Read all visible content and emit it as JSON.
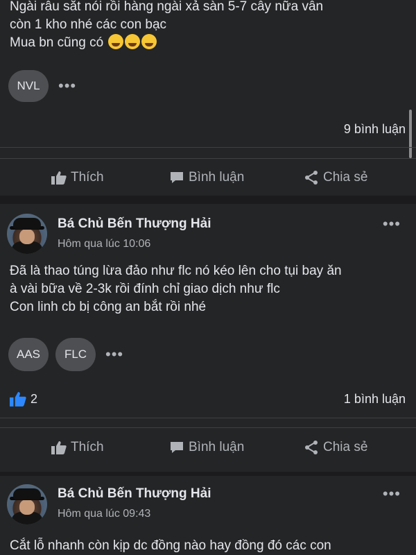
{
  "posts": [
    {
      "text_lines": [
        "Ngài râu sắt nói rồi hàng ngài xả sàn 5-7 cây nữa vẫn",
        "còn 1 kho nhé các con bạc",
        "Mua bn cũng có"
      ],
      "emoji_icons": [
        "tears-of-joy-emoji",
        "star-struck-emoji",
        "smiling-face-emoji"
      ],
      "tags": [
        "NVL"
      ],
      "comments": "9 bình luận"
    },
    {
      "author": "Bá Chủ Bến Thượng Hải",
      "time": "Hôm qua lúc 10:06",
      "text_lines": [
        "Đã là thao túng lừa đảo như flc nó kéo lên cho tụi bay ăn",
        "à vài bữa về 2-3k rồi đính chỉ giao dịch như flc",
        "Con linh cb bị công an bắt rồi nhé"
      ],
      "tags": [
        "AAS",
        "FLC"
      ],
      "likes": "2",
      "comments": "1 bình luận"
    },
    {
      "author": "Bá Chủ Bến Thượng Hải",
      "time": "Hôm qua lúc 09:43",
      "text_lines": [
        "Cắt lỗ nhanh còn kịp dc đồng nào hay đồng đó các con"
      ]
    }
  ],
  "actions": {
    "like": "Thích",
    "comment": "Bình luận",
    "share": "Chia sẻ"
  },
  "more_label": "•••",
  "colors": {
    "background": "#1b1b1d",
    "card": "#242526",
    "text": "#e4e6eb",
    "muted": "#b0b3b8",
    "like_blue": "#2d88ff"
  }
}
